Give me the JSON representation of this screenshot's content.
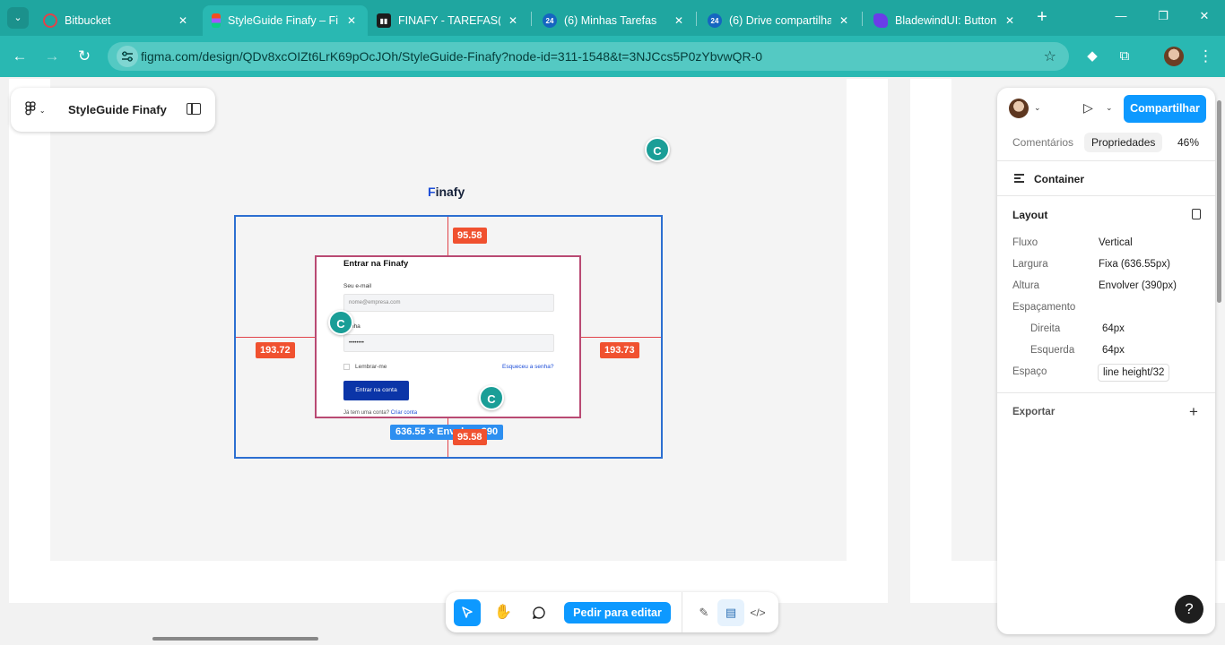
{
  "browser": {
    "tabs": [
      {
        "title": "Bitbucket",
        "favicon": "bitbucket-icon",
        "color": "#e0434a"
      },
      {
        "title": "StyleGuide Finafy – Fi",
        "favicon": "figma-icon",
        "color": "#a259ff"
      },
      {
        "title": "FINAFY - TAREFAS(BIT",
        "favicon": "trello-icon",
        "color": "#1c1c1c"
      },
      {
        "title": "(6) Minhas Tarefas",
        "favicon": "bitrix24-icon",
        "color": "#1565c0"
      },
      {
        "title": "(6) Drive compartilha",
        "favicon": "bitrix24-icon",
        "color": "#1565c0"
      },
      {
        "title": "BladewindUI: Button c",
        "favicon": "bladewind-icon",
        "color": "#6a3de8"
      }
    ],
    "url": "figma.com/design/QDv8xcOIZt6LrK69pOcJOh/StyleGuide-Finafy?node-id=311-1548&t=3NJCcs5P0zYbvwQR-0",
    "badge_24": "24"
  },
  "figma": {
    "file_name": "StyleGuide Finafy",
    "cursor_initial": "C",
    "brand": {
      "prefix": "F",
      "rest": "inafy"
    },
    "measurements": {
      "top": "95.58",
      "bottom": "95.58",
      "left": "193.72",
      "right": "193.73"
    },
    "dimension_label": "636.55 × Envolver 390",
    "login": {
      "title": "Entrar na Finafy",
      "email_label": "Seu e-mail",
      "email_placeholder": "nome@empresa.com",
      "password_label": "Senha",
      "password_value": "••••••••",
      "remember": "Lembrar-me",
      "forgot": "Esqueceu a senha?",
      "submit": "Entrar na conta",
      "footer_text": "Já tem uma conta?",
      "footer_link": "Criar conta"
    },
    "toolbar": {
      "edit_request": "Pedir para editar"
    }
  },
  "properties": {
    "share": "Compartilhar",
    "tabs": {
      "comments": "Comentários",
      "properties": "Propriedades"
    },
    "zoom": "46%",
    "layer_name": "Container",
    "layout": {
      "title": "Layout",
      "rows": [
        {
          "label": "Fluxo",
          "value": "Vertical"
        },
        {
          "label": "Largura",
          "value": "Fixa (636.55px)"
        },
        {
          "label": "Altura",
          "value": "Envolver (390px)"
        },
        {
          "label": "Espaçamento",
          "value": ""
        },
        {
          "label": "Direita",
          "value": "64px"
        },
        {
          "label": "Esquerda",
          "value": "64px"
        },
        {
          "label": "Espaço",
          "value": "line height/32"
        }
      ]
    },
    "export": "Exportar",
    "help": "?"
  }
}
